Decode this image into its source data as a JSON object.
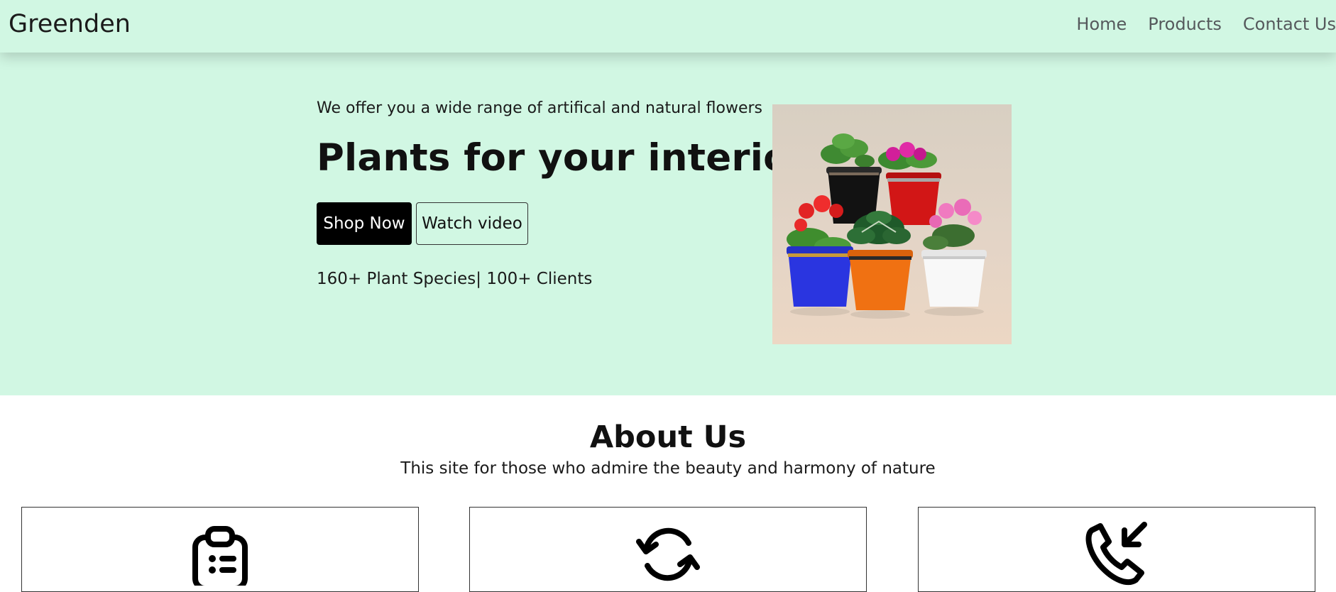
{
  "navbar": {
    "brand": "Greenden",
    "links": [
      "Home",
      "Products",
      "Contact Us"
    ]
  },
  "hero": {
    "subtitle": "We offer you a wide range of artifical and natural flowers",
    "title": "Plants for your interior",
    "primary_button": "Shop Now",
    "secondary_button": "Watch video",
    "stats": "160+ Plant Species| 100+ Clients",
    "image": "potted-flowers-photo"
  },
  "about": {
    "title": "About Us",
    "subtitle": "This site for those who admire the beauty and harmony of nature",
    "cards": [
      {
        "icon": "clipboard-list-icon"
      },
      {
        "icon": "refresh-icon"
      },
      {
        "icon": "phone-incoming-icon"
      }
    ]
  },
  "colors": {
    "hero_background": "#d1f7e3",
    "primary_button": "#000000",
    "nav_link": "#55595c"
  }
}
